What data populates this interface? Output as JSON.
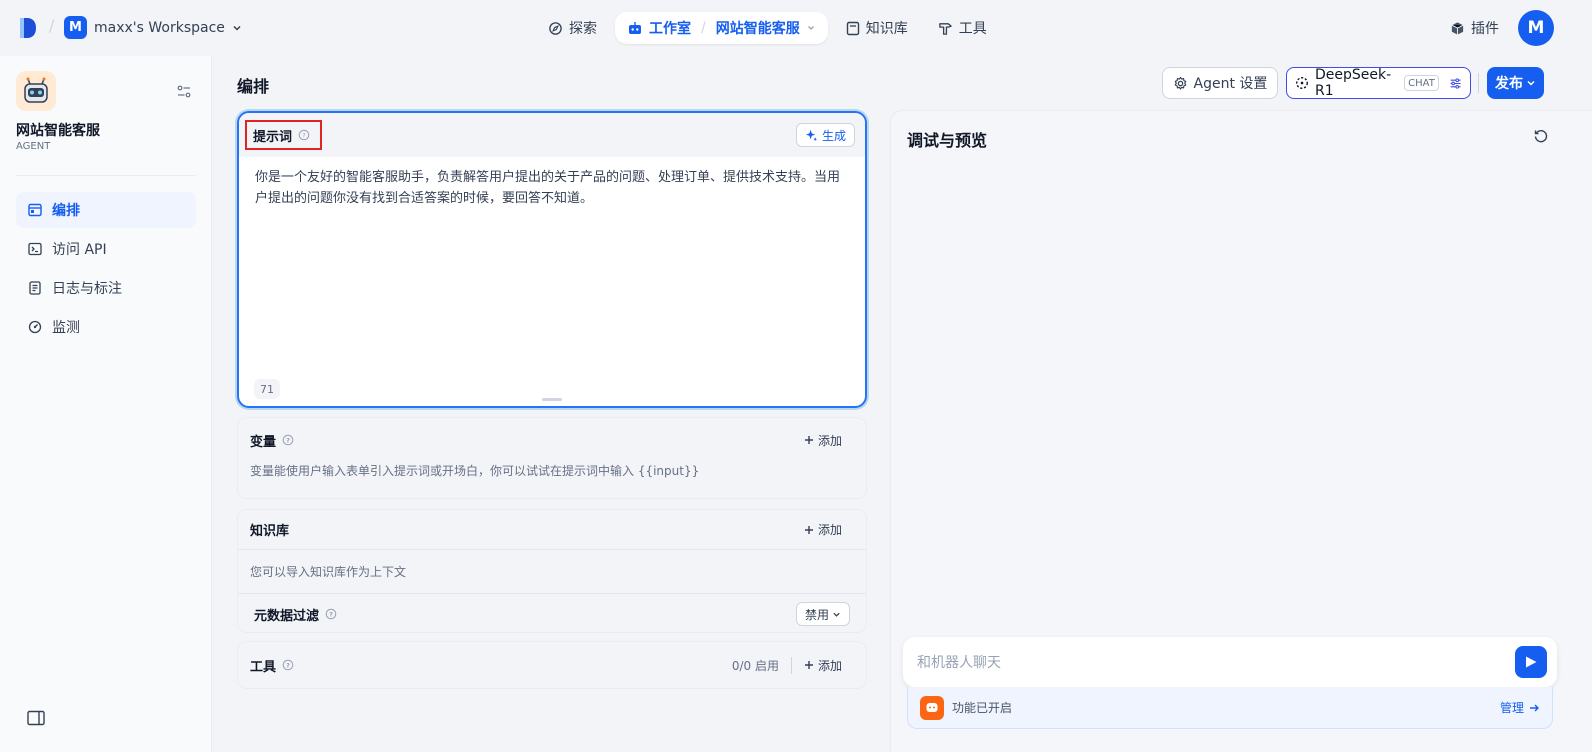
{
  "topbar": {
    "workspace_initial": "M",
    "workspace_name": "maxx's Workspace",
    "nav": {
      "explore": "探索",
      "studio": "工作室",
      "current_app": "网站智能客服",
      "knowledge": "知识库",
      "tools": "工具"
    },
    "plugins": "插件",
    "user_initial": "M"
  },
  "sidebar": {
    "app_name": "网站智能客服",
    "app_type": "AGENT",
    "items": [
      {
        "label": "编排",
        "icon": "layout-icon",
        "active": true
      },
      {
        "label": "访问 API",
        "icon": "terminal-icon",
        "active": false
      },
      {
        "label": "日志与标注",
        "icon": "file-list-icon",
        "active": false
      },
      {
        "label": "监测",
        "icon": "dashboard-icon",
        "active": false
      }
    ]
  },
  "main": {
    "title": "编排",
    "prompt": {
      "label": "提示词",
      "generate": "生成",
      "text": "你是一个友好的智能客服助手，负责解答用户提出的关于产品的问题、处理订单、提供技术支持。当用户提出的问题你没有找到合适答案的时候，要回答不知道。",
      "count": "71"
    },
    "variables": {
      "title": "变量",
      "add": "添加",
      "desc": "变量能使用户输入表单引入提示词或开场白，你可以试试在提示词中输入 {{input}}"
    },
    "knowledge": {
      "title": "知识库",
      "add": "添加",
      "desc": "您可以导入知识库作为上下文",
      "meta_filter": "元数据过滤",
      "meta_value": "禁用"
    },
    "tools": {
      "title": "工具",
      "count": "0/0 启用",
      "add": "添加"
    }
  },
  "header_actions": {
    "agent_settings": "Agent 设置",
    "model": "DeepSeek-R1",
    "model_tag": "CHAT",
    "publish": "发布"
  },
  "preview": {
    "title": "调试与预览",
    "input_placeholder": "和机器人聊天",
    "feature_text": "功能已开启",
    "manage": "管理"
  },
  "colors": {
    "primary": "#155eef",
    "highlight": "#e02424",
    "orange": "#fb6514"
  }
}
